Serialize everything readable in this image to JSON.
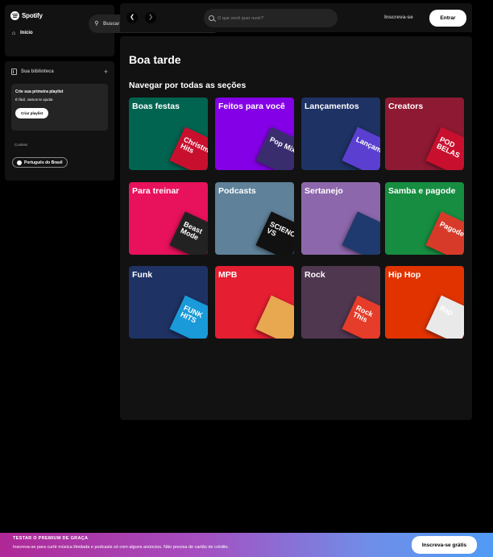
{
  "app": {
    "name": "Spotify"
  },
  "sidebar": {
    "nav": [
      {
        "label": "Início",
        "icon": "home-icon"
      },
      {
        "label": "Buscar",
        "icon": "search-icon"
      }
    ],
    "library": {
      "title": "Sua biblioteca",
      "add_icon": "plus-icon",
      "playlist_card": {
        "title": "Crie sua primeira playlist",
        "subtitle": "É fácil, vamos te ajudar.",
        "button": "Criar playlist"
      },
      "cookies_label": "Cookies",
      "language_button": "Português do Brasil"
    }
  },
  "header": {
    "search_placeholder": "O que você quer ouvir?",
    "signup_label": "Inscreva-se",
    "login_label": "Entrar"
  },
  "main": {
    "greeting": "Boa tarde",
    "section_title": "Navegar por todas as seções",
    "categories": [
      {
        "label": "Boas festas",
        "color": "#006450",
        "art_color": "#c8102e",
        "art_text": "Christmas Hits"
      },
      {
        "label": "Feitos para você",
        "color": "#8400e7",
        "art_color": "#3a2d6e",
        "art_text": "Pop Mix"
      },
      {
        "label": "Lançamentos",
        "color": "#1e3264",
        "art_color": "#5a3fd0",
        "art_text": "Lançamentos"
      },
      {
        "label": "Creators",
        "color": "#8d1932",
        "art_color": "#c8102e",
        "art_text": "POD BELAS"
      },
      {
        "label": "Para treinar",
        "color": "#e8115b",
        "art_color": "#222222",
        "art_text": "Beast Mode"
      },
      {
        "label": "Podcasts",
        "color": "#5f8199",
        "art_color": "#111111",
        "art_text": "SCIENCE VS"
      },
      {
        "label": "Sertanejo",
        "color": "#8d67ab",
        "art_color": "#1e3a6e",
        "art_text": ""
      },
      {
        "label": "Samba e pagode",
        "color": "#168d40",
        "art_color": "#d83a2a",
        "art_text": "Pagode"
      },
      {
        "label": "Funk",
        "color": "#1e3264",
        "art_color": "#1a9ad8",
        "art_text": "FUNK HITS"
      },
      {
        "label": "MPB",
        "color": "#e61e32",
        "art_color": "#e8a850",
        "art_text": ""
      },
      {
        "label": "Rock",
        "color": "#503750",
        "art_color": "#e63c2a",
        "art_text": "Rock This"
      },
      {
        "label": "Hip Hop",
        "color": "#e13300",
        "art_color": "#e9e9e9",
        "art_text": "Rap"
      }
    ]
  },
  "banner": {
    "title": "TESTAR O PREMIUM DE GRAÇA",
    "description": "Inscreva-se para curtir música ilimitada e podcasts só com alguns anúncios. Não precisa de cartão de crédito.",
    "button": "Inscreva-se grátis"
  }
}
